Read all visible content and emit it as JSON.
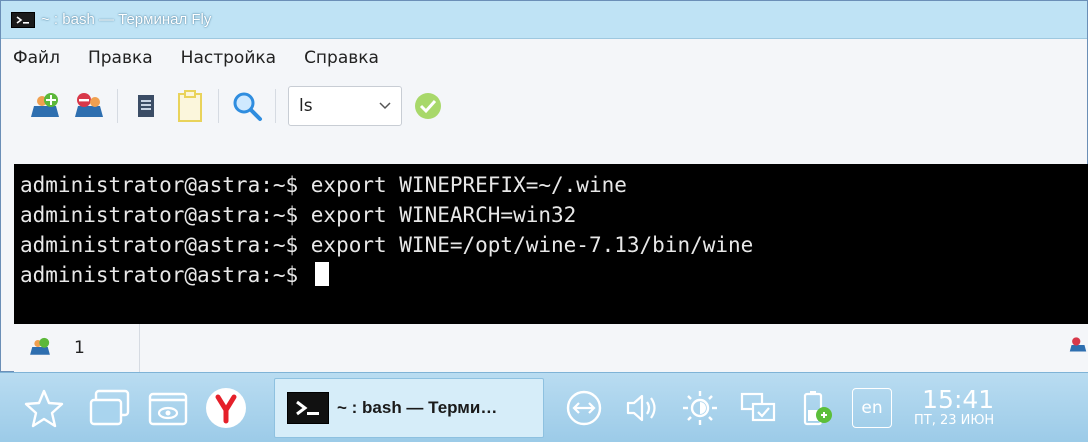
{
  "window": {
    "title": "~ : bash — Терминал Fly"
  },
  "menu": [
    "Файл",
    "Правка",
    "Настройка",
    "Справка"
  ],
  "toolbar": {
    "combo_value": "ls",
    "icons": [
      "new-tab-icon",
      "close-tab-icon",
      "copy-icon",
      "paste-icon",
      "find-icon",
      "confirm-icon"
    ]
  },
  "terminal": {
    "lines": [
      "administrator@astra:~$ export WINEPREFIX=~/.wine",
      "administrator@astra:~$ export WINEARCH=win32",
      "administrator@astra:~$ export WINE=/opt/wine-7.13/bin/wine"
    ],
    "prompt": "administrator@astra:~$ "
  },
  "tabs": [
    {
      "label": "1"
    }
  ],
  "taskbar": {
    "task_label": "~ : bash — Терми…",
    "lang": "en",
    "time": "15:41",
    "date": "ПТ, 23 ИЮН"
  }
}
